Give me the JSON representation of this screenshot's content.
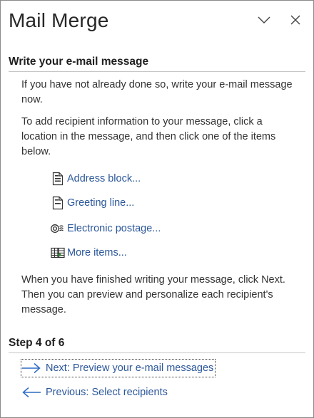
{
  "pane": {
    "title": "Mail Merge",
    "minimize_icon": "chevron-down-icon",
    "close_icon": "close-icon"
  },
  "section": {
    "heading": "Write your e-mail message",
    "intro": "If you have not already done so, write your e-mail message now.",
    "instructions": "To add recipient information to your message, click a location in the message, and then click one of the items below.",
    "items": [
      {
        "label": "Address block...",
        "icon": "address-block-icon"
      },
      {
        "label": "Greeting line...",
        "icon": "greeting-line-icon"
      },
      {
        "label": "Electronic postage...",
        "icon": "electronic-postage-icon"
      },
      {
        "label": "More items...",
        "icon": "more-items-icon"
      }
    ],
    "footer": "When you have finished writing your message, click Next. Then you can preview and personalize each recipient's message."
  },
  "step": {
    "label": "Step 4 of 6",
    "next_label": "Next: Preview your e-mail messages",
    "previous_label": "Previous: Select recipients"
  },
  "colors": {
    "link": "#2b579a",
    "arrow": "#2b6cc4"
  }
}
